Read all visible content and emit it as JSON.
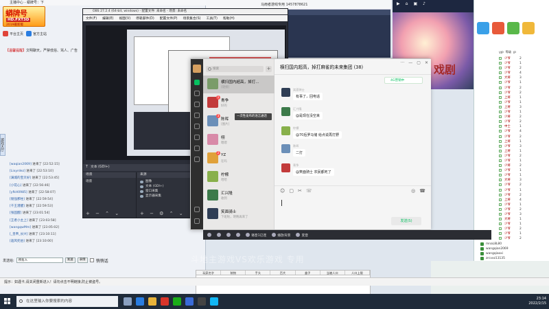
{
  "left_window": {
    "title": "主播中心 - 蟒牌号：下",
    "logo_line1": "蟒牌号",
    "logo_line2": "HD.FXT3D",
    "logo_line3": "2019最新版",
    "toolbar": [
      {
        "label": "平台主页",
        "icon": "home-icon",
        "color": "#e0443a"
      },
      {
        "label": "官方主站",
        "icon": "globe-icon",
        "color": "#2a7de1"
      }
    ],
    "notice_tag": "【温馨提醒】",
    "notice_text": "文明聊天，严禁低俗、骂人、广告",
    "side_tab": "游戏大厅",
    "chat_log": [
      {
        "user": "[waqian2069]",
        "text": "进来了 [22:52:15]"
      },
      {
        "user": "[Lixyrdez]",
        "text": "进来了 [22:53:10]"
      },
      {
        "user": "[满城的宝贝好]",
        "text": "进来了 [22:53:45]"
      },
      {
        "user": "[小花心]",
        "text": "进来了 [22:56:46]"
      },
      {
        "user": "[yfkH0985]",
        "text": "进来了 [22:58:07]"
      },
      {
        "user": "[倔强那柱]",
        "text": "进来了 [22:59:54]"
      },
      {
        "user": "[千王潜醒]",
        "text": "进来了 [22:59:53]"
      },
      {
        "user": "[张固醒]",
        "text": "进来了 [23:01:54]"
      },
      {
        "user": "[王者小主上]",
        "text": "进来了 [23:03:58]"
      },
      {
        "user": "[wangqwMm]",
        "text": "进来了 [23:05:02]"
      },
      {
        "user": "[_皇帝_长兴]",
        "text": "进来了 [23:10:11]"
      },
      {
        "user": "[迦风兜伯]",
        "text": "进来了 [23:10:00]"
      }
    ],
    "send_label": "发送给:",
    "send_target": "所有人",
    "send_button": "发送",
    "emoji_button": "表情",
    "checkbox_label": "悄悄话",
    "status_bar": "提示：如遇卡,请关闭重新进入！请勿点击不明链接,防止被盗号。"
  },
  "obs": {
    "title": "OBS 27.2.4 (64-bit, windows) - 配置文件: 未命名 - 场景: 未命名",
    "menu": [
      "文件(F)",
      "编辑(E)",
      "视图(V)",
      "停靠部件(D)",
      "配置文件(P)",
      "场景集合(S)",
      "工具(T)",
      "帮助(H)"
    ],
    "text_source_bar": "文本 (GDI+)",
    "docks": {
      "scenes_label": "场景",
      "scene_item": "场景",
      "sources_label": "来源",
      "sources": [
        "图像",
        "文本 (GDI+)",
        "窗口采集",
        "显示器采集"
      ]
    }
  },
  "game_window": {
    "tabs": [
      "界面",
      "账号",
      "推荐",
      "设置"
    ]
  },
  "mid_title": "马雨者游戏专用  1457878621",
  "wechat": {
    "search_placeholder": "搜索",
    "add_label": "+",
    "chat_title": "横扫国内超高，掉打麻雀的未来集团 (38)",
    "green_button": "4G营销中",
    "conversations": [
      {
        "name": "横扫国内超高，掉打...",
        "preview": "[链接]",
        "active": true,
        "badge": "",
        "color": "#7a9c6a"
      },
      {
        "name": "青争",
        "preview": "好的",
        "active": false,
        "badge": "1",
        "color": "#c23b3b"
      },
      {
        "name": "陈晖",
        "preview": "[图片]",
        "active": false,
        "badge": "3",
        "color": "#6b8fb8"
      },
      {
        "name": "栩",
        "preview": "嗯嗯",
        "active": false,
        "badge": "",
        "color": "#d88aa8"
      },
      {
        "name": "YZ",
        "preview": "在吗",
        "active": false,
        "badge": "2",
        "color": "#e0a13a"
      },
      {
        "name": "柠檬",
        "preview": "哈哈",
        "active": false,
        "badge": "",
        "color": "#88b04b"
      },
      {
        "name": "汇兴隆",
        "preview": "收到",
        "active": false,
        "badge": "",
        "color": "#3c7a4a"
      },
      {
        "name": "笑面骑士",
        "preview": "下班啦，明晚再来了",
        "active": false,
        "badge": "",
        "color": "#2f3e55"
      }
    ],
    "tooltip": "一次性发布的语言通话",
    "messages": [
      {
        "name": "笑面骑士",
        "text": "有事了，回电话",
        "color": "#2f3e55"
      },
      {
        "name": "汇兴隆",
        "text": "@是现在没空来",
        "color": "#3c7a4a"
      },
      {
        "name": "柠檬",
        "text": "@70后罗马储 给点说再打野",
        "color": "#88b04b"
      },
      {
        "name": "陈晖",
        "text": "二打",
        "color": "#6b8fb8"
      },
      {
        "name": "青争",
        "text": "@笑面骑士 农民都死了",
        "color": "#c23b3b"
      }
    ],
    "input_tools": [
      "☺",
      "▢",
      "✂",
      "☏"
    ],
    "input_right": [
      "◎",
      "☎"
    ],
    "send_button": "发送(S)"
  },
  "voice_bar": {
    "items": [
      {
        "label": "",
        "icon": "mic-icon"
      },
      {
        "label": "",
        "icon": "speaker-icon"
      },
      {
        "label": "",
        "icon": "headset-icon"
      },
      {
        "label": "",
        "icon": "eq-icon"
      },
      {
        "label": "语音1已连",
        "icon": "call-icon"
      },
      {
        "label": "播放背景",
        "icon": "music-icon"
      },
      {
        "label": "变音",
        "icon": "voice-change-icon"
      }
    ]
  },
  "right_panel": {
    "header": [
      "VIP",
      "等级",
      "IP"
    ],
    "rows": [
      {
        "c1": "少爷",
        "c2": "2"
      },
      {
        "c1": "少爷",
        "c2": "1"
      },
      {
        "c1": "少爷",
        "c2": "2"
      },
      {
        "c1": "少爷",
        "c2": "4"
      },
      {
        "c1": "大将",
        "c2": "3"
      },
      {
        "c1": "少爷",
        "c2": "1"
      },
      {
        "c1": "少爷",
        "c2": "2"
      },
      {
        "c1": "少爷",
        "c2": "2"
      },
      {
        "c1": "上将",
        "c2": "1"
      },
      {
        "c1": "少爷",
        "c2": "1"
      },
      {
        "c1": "上将",
        "c2": "3"
      },
      {
        "c1": "少爷",
        "c2": "1"
      },
      {
        "c1": "少将",
        "c2": "2"
      },
      {
        "c1": "少爷",
        "c2": "2"
      },
      {
        "c1": "中士",
        "c2": "1"
      },
      {
        "c1": "少爷",
        "c2": "4"
      },
      {
        "c1": "少爷",
        "c2": "2"
      },
      {
        "c1": "上将",
        "c2": "1"
      },
      {
        "c1": "少爷",
        "c2": "3"
      },
      {
        "c1": "上将",
        "c2": "1"
      },
      {
        "c1": "少爷",
        "c2": "2"
      },
      {
        "c1": "少爷",
        "c2": "1"
      },
      {
        "c1": "少将",
        "c2": "2"
      },
      {
        "c1": "少爷",
        "c2": "1"
      },
      {
        "c1": "少爷",
        "c2": "1"
      },
      {
        "c1": "大将",
        "c2": "3"
      },
      {
        "c1": "少爷",
        "c2": "2"
      },
      {
        "c1": "少爷",
        "c2": "1"
      },
      {
        "c1": "少爷",
        "c2": "2"
      },
      {
        "c1": "上将",
        "c2": "4"
      },
      {
        "c1": "少爷",
        "c2": "1"
      },
      {
        "c1": "少爷",
        "c2": "2"
      },
      {
        "c1": "少爷",
        "c2": "3"
      },
      {
        "c1": "大将",
        "c2": "1"
      },
      {
        "c1": "少爷",
        "c2": "1"
      },
      {
        "c1": "少爷",
        "c2": "2"
      },
      {
        "c1": "少爷",
        "c2": "1"
      },
      {
        "c1": "少爷",
        "c2": "2"
      }
    ],
    "users": [
      "mnaL8L80",
      "wangqian2069",
      "wangqiaoxi",
      "zrcvxz13135"
    ]
  },
  "qq_window": {
    "tabs": [
      "▶",
      "⌂",
      "▣",
      "♪"
    ]
  },
  "art_text": "戏剧",
  "sheet": {
    "headers": [
      "玩家名字",
      "装物",
      "手头",
      "百大",
      "盒子",
      "当被人口",
      "人口上限"
    ]
  },
  "watermark": "斗地主游戏VS欢乐游戏 专用",
  "taskbar": {
    "search_placeholder": "在这里输入你要搜索的内容",
    "time": "23:14",
    "date": "2022/2/15",
    "apps": [
      {
        "icon": "taskview-icon",
        "color": "#8aa0c0"
      },
      {
        "icon": "edge-icon",
        "color": "#2a7de1"
      },
      {
        "icon": "explorer-icon",
        "color": "#e8b33a"
      },
      {
        "icon": "app-red-icon",
        "color": "#d8352a"
      },
      {
        "icon": "wechat-icon",
        "color": "#1aad19"
      },
      {
        "icon": "app-blue-icon",
        "color": "#3a6bd8"
      },
      {
        "icon": "obs-icon",
        "color": "#444"
      },
      {
        "icon": "qq-icon",
        "color": "#12b7f5"
      }
    ]
  }
}
